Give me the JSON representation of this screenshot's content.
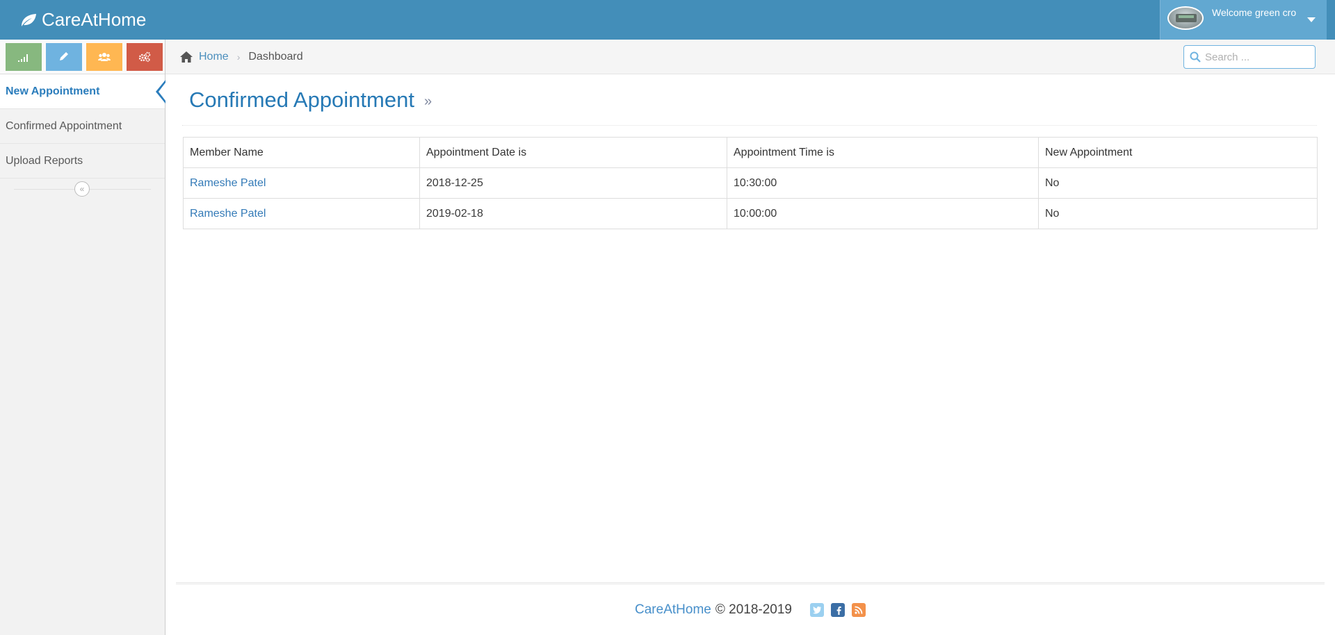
{
  "navbar": {
    "brand": "CareAtHome",
    "welcome": "Welcome green cro"
  },
  "sidebar": {
    "items": [
      {
        "label": "New Appointment"
      },
      {
        "label": "Confirmed Appointment"
      },
      {
        "label": "Upload Reports"
      }
    ],
    "collapse_symbol": "«"
  },
  "breadcrumb": {
    "home": "Home",
    "current": "Dashboard"
  },
  "search": {
    "placeholder": "Search ..."
  },
  "page": {
    "title": "Confirmed Appointment",
    "title_arrow": "»"
  },
  "table": {
    "headers": [
      "Member Name",
      "Appointment Date is",
      "Appointment Time is",
      "New Appointment"
    ],
    "rows": [
      [
        "Rameshe Patel",
        "2018-12-25",
        "10:30:00",
        "No"
      ],
      [
        "Rameshe Patel",
        "2019-02-18",
        "10:00:00",
        "No"
      ]
    ]
  },
  "footer": {
    "brand": "CareAtHome",
    "copyright": "© 2018-2019"
  },
  "colors": {
    "navbar": "#438eb9",
    "accent": "#2679b5",
    "green": "#87b87f",
    "blue": "#6fb3e0",
    "orange": "#ffb752",
    "red": "#d15b47"
  }
}
